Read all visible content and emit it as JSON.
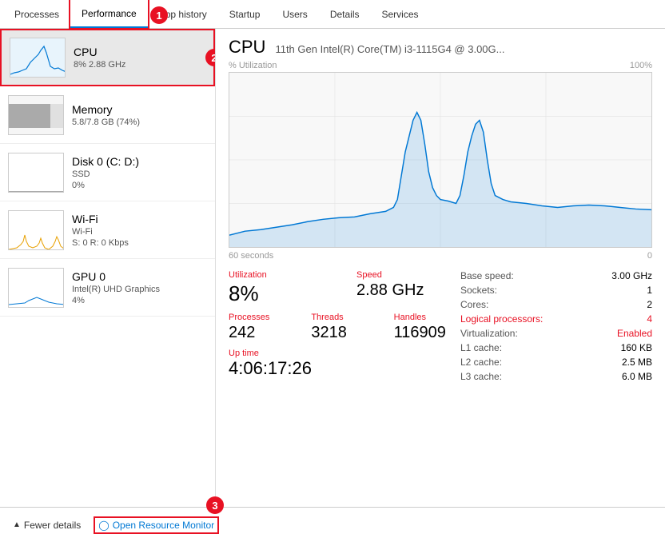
{
  "tabs": [
    {
      "label": "Processes",
      "active": false
    },
    {
      "label": "Performance",
      "active": true
    },
    {
      "label": "App history",
      "active": false
    },
    {
      "label": "Startup",
      "active": false
    },
    {
      "label": "Users",
      "active": false
    },
    {
      "label": "Details",
      "active": false
    },
    {
      "label": "Services",
      "active": false
    }
  ],
  "sidebar": {
    "items": [
      {
        "name": "CPU",
        "sub1": "8% 2.88 GHz",
        "sub2": "",
        "active": true
      },
      {
        "name": "Memory",
        "sub1": "5.8/7.8 GB (74%)",
        "sub2": "",
        "active": false
      },
      {
        "name": "Disk 0 (C: D:)",
        "sub1": "SSD",
        "sub2": "0%",
        "active": false
      },
      {
        "name": "Wi-Fi",
        "sub1": "Wi-Fi",
        "sub2": "S: 0 R: 0 Kbps",
        "active": false
      },
      {
        "name": "GPU 0",
        "sub1": "Intel(R) UHD Graphics",
        "sub2": "4%",
        "active": false
      }
    ]
  },
  "cpu_panel": {
    "title": "CPU",
    "subtitle": "11th Gen Intel(R) Core(TM) i3-1115G4 @ 3.00G...",
    "chart_left_label": "% Utilization",
    "chart_right_label": "100%",
    "time_left": "60 seconds",
    "time_right": "0",
    "utilization_label": "Utilization",
    "utilization_value": "8%",
    "speed_label": "Speed",
    "speed_value": "2.88 GHz",
    "processes_label": "Processes",
    "processes_value": "242",
    "threads_label": "Threads",
    "threads_value": "3218",
    "handles_label": "Handles",
    "handles_value": "116909",
    "uptime_label": "Up time",
    "uptime_value": "4:06:17:26",
    "specs": [
      {
        "key": "Base speed:",
        "value": "3.00 GHz",
        "highlight": false
      },
      {
        "key": "Sockets:",
        "value": "1",
        "highlight": false
      },
      {
        "key": "Cores:",
        "value": "2",
        "highlight": false
      },
      {
        "key": "Logical processors:",
        "value": "4",
        "highlight": true
      },
      {
        "key": "Virtualization:",
        "value": "Enabled",
        "highlight": true
      },
      {
        "key": "L1 cache:",
        "value": "160 KB",
        "highlight": false
      },
      {
        "key": "L2 cache:",
        "value": "2.5 MB",
        "highlight": false
      },
      {
        "key": "L3 cache:",
        "value": "6.0 MB",
        "highlight": false
      }
    ]
  },
  "footer": {
    "fewer_details": "Fewer details",
    "open_resource": "Open Resource Monitor"
  },
  "annotations": {
    "tab_number": "1",
    "arrow_number": "2",
    "footer_number": "3"
  }
}
